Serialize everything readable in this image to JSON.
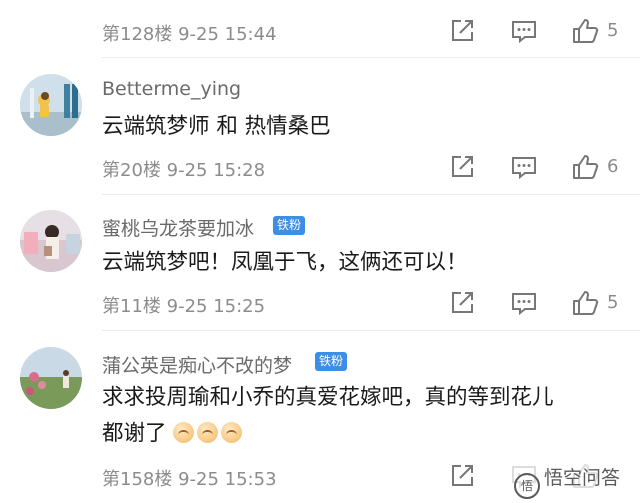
{
  "colors": {
    "meta_gray": "#8c8c8c",
    "badge_blue": "#3d8fe6",
    "text_dark": "#1a1a1a"
  },
  "top_meta": {
    "floor_time": "第128楼  9-25 15:44",
    "likes": "5"
  },
  "comments": [
    {
      "username": "Betterme_ying",
      "badge": "",
      "text": "云端筑梦师 和 热情桑巴",
      "floor_time": "第20楼  9-25 15:28",
      "likes": "6"
    },
    {
      "username": "蜜桃乌龙茶要加冰",
      "badge": "铁粉",
      "text": "云端筑梦吧！凤凰于飞，这俩还可以！",
      "floor_time": "第11楼  9-25 15:25",
      "likes": "5"
    },
    {
      "username": "蒲公英是痴心不改的梦",
      "badge": "铁粉",
      "text_line1": "求求投周瑜和小乔的真爱花嫁吧，真的等到花儿",
      "text_line2": "都谢了",
      "floor_time": "第158楼  9-25 15:53",
      "likes": ""
    }
  ],
  "icons": {
    "share": "share-icon",
    "reply": "reply-icon",
    "like": "thumbs-up-icon",
    "emoji": "sleepy-face-emoji-icon"
  },
  "watermark": {
    "text": "悟空问答"
  }
}
